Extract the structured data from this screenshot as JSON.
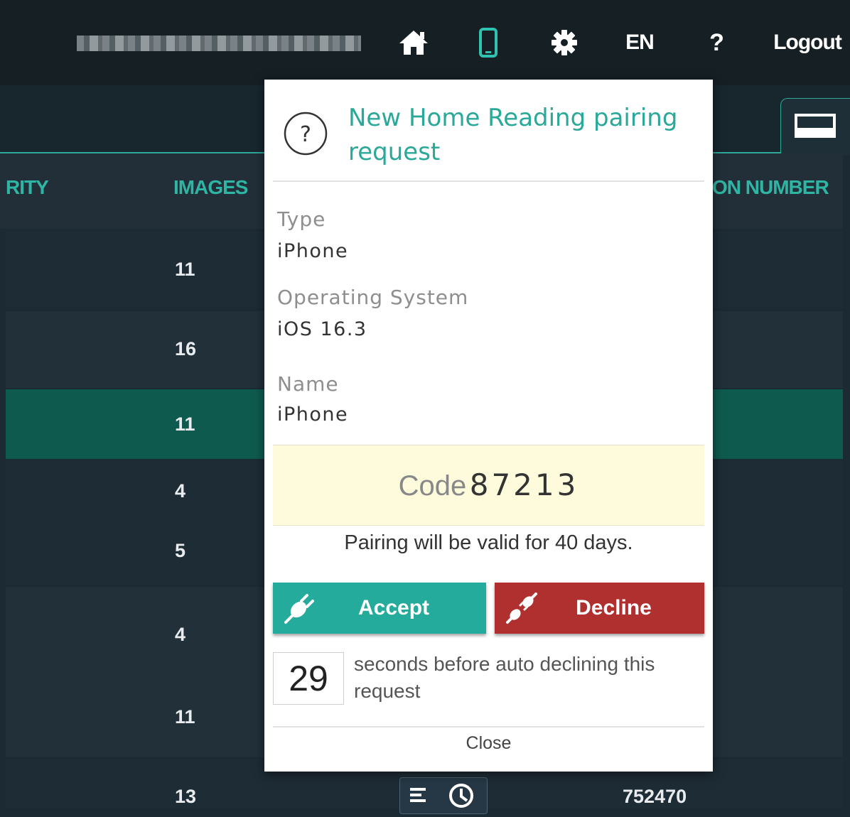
{
  "topbar": {
    "lang_label": "EN",
    "help_label": "?",
    "logout_label": "Logout",
    "icons": [
      "home-icon",
      "mobile-icon",
      "gear-icon"
    ]
  },
  "table": {
    "headers": [
      "RITY",
      "IMAGES",
      "ON NUMBER"
    ],
    "rows": [
      {
        "images": "11",
        "number": "",
        "bg": "#1e2c35"
      },
      {
        "images": "16",
        "number": "",
        "bg": "#223039"
      },
      {
        "images": "11",
        "number": "",
        "bg": "#0f5a4e"
      },
      {
        "images": "4",
        "number": "",
        "bg": "#1e2c35"
      },
      {
        "images": "5",
        "number": "",
        "bg": "#1e2c35"
      },
      {
        "images": "4",
        "number": "",
        "bg": "#223039"
      },
      {
        "images": "11",
        "number": "",
        "bg": "#223039"
      },
      {
        "images": "13",
        "number": "752470",
        "bg": "#1e2c35"
      }
    ]
  },
  "modal": {
    "title": "New Home Reading pairing request",
    "fields": [
      {
        "label": "Type",
        "value": "iPhone"
      },
      {
        "label": "Operating System",
        "value": "iOS 16.3"
      },
      {
        "label": "Name",
        "value": "iPhone"
      }
    ],
    "code_label": "Code",
    "code_value": "87213",
    "valid_text": "Pairing will be valid for 40 days.",
    "accept_label": "Accept",
    "decline_label": "Decline",
    "countdown_value": "29",
    "countdown_text": "seconds before auto declining this request",
    "close_label": "Close"
  },
  "colors": {
    "accent_teal": "#2aa899",
    "accept_button": "#24ab9b",
    "decline_button": "#b02f2f",
    "code_background": "#fdfbdb",
    "selected_row": "#0f5a4e"
  }
}
